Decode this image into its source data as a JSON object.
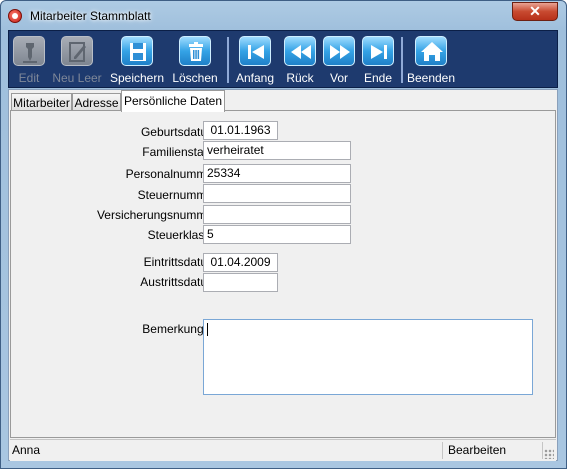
{
  "window": {
    "title": "Mitarbeiter Stammblatt",
    "close_label": "✕"
  },
  "toolbar": {
    "buttons": [
      {
        "id": "edit",
        "label": "Edit",
        "icon": "pen-icon",
        "enabled": false
      },
      {
        "id": "new",
        "label": "Neu Leer",
        "icon": "new-document-icon",
        "enabled": false
      },
      {
        "id": "save",
        "label": "Speichern",
        "icon": "floppy-disk-icon",
        "enabled": true
      },
      {
        "id": "delete",
        "label": "Löschen",
        "icon": "trash-icon",
        "enabled": true
      },
      {
        "id": "first",
        "label": "Anfang",
        "icon": "first-record-icon",
        "enabled": true
      },
      {
        "id": "back",
        "label": "Rück",
        "icon": "previous-icon",
        "enabled": true
      },
      {
        "id": "forward",
        "label": "Vor",
        "icon": "next-icon",
        "enabled": true
      },
      {
        "id": "last",
        "label": "Ende",
        "icon": "last-record-icon",
        "enabled": true
      },
      {
        "id": "exit",
        "label": "Beenden",
        "icon": "home-icon",
        "enabled": true
      }
    ]
  },
  "tabs": [
    {
      "label": "Mitarbeiter",
      "active": false
    },
    {
      "label": "Adresse",
      "active": false
    },
    {
      "label": "Persönliche Daten",
      "active": true
    }
  ],
  "form": {
    "geburtsdatum": {
      "label": "Geburtsdatum",
      "value": "01.01.1963"
    },
    "familienstand": {
      "label": "Familienstand",
      "value": "verheiratet"
    },
    "personalnummer": {
      "label": "Personalnummer",
      "value": "25334"
    },
    "steuernummer": {
      "label": "Steuernummer",
      "value": ""
    },
    "versicherungsnummer": {
      "label": "Versicherungsnummer",
      "value": ""
    },
    "steuerklasse": {
      "label": "Steuerklasse",
      "value": "5"
    },
    "eintrittsdatum": {
      "label": "Eintrittsdatum",
      "value": "01.04.2009"
    },
    "austrittsdatum": {
      "label": "Austrittsdatum",
      "value": ""
    },
    "bemerkungen": {
      "label": "Bemerkungen",
      "value": ""
    }
  },
  "status": {
    "user": "Anna",
    "mode": "Bearbeiten"
  }
}
